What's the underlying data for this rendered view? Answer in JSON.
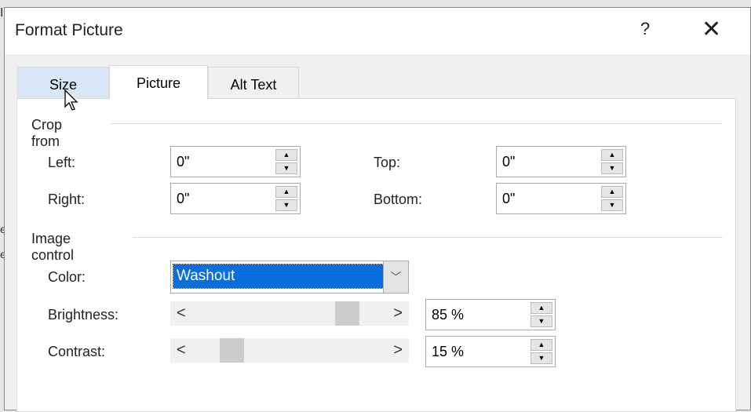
{
  "dialog": {
    "title": "Format Picture",
    "help": "?",
    "close": "✕"
  },
  "tabs": [
    {
      "label": "Size"
    },
    {
      "label": "Picture"
    },
    {
      "label": "Alt Text"
    }
  ],
  "crop": {
    "heading": "Crop from",
    "left_label": "Left:",
    "left_value": "0\"",
    "top_label": "Top:",
    "top_value": "0\"",
    "right_label": "Right:",
    "right_value": "0\"",
    "bottom_label": "Bottom:",
    "bottom_value": "0\""
  },
  "image_control": {
    "heading": "Image control",
    "color_label": "Color:",
    "color_value": "Washout",
    "brightness_label": "Brightness:",
    "brightness_value": "85 %",
    "brightness": 85,
    "contrast_label": "Contrast:",
    "contrast_value": "15 %",
    "contrast": 15
  },
  "background": {
    "t1": "I",
    "t2": "e",
    "t3": "e"
  }
}
